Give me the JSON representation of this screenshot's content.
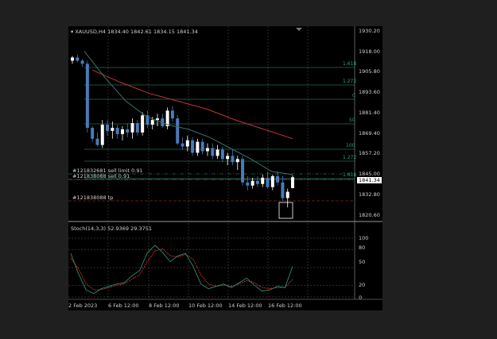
{
  "symbol_header": {
    "symbol": "XAUUSD,H4",
    "open": "1834.40",
    "high": "1842.61",
    "low": "1834.15",
    "close": "1841.34"
  },
  "price_scale": [
    "1930.20",
    "1918.00",
    "1905.80",
    "1893.60",
    "1881.40",
    "1869.40",
    "1857.20",
    "1845.00",
    "1832.80",
    "1820.60"
  ],
  "current_price": "1841.34",
  "fib_levels": [
    "1.618",
    "1.272",
    "0",
    "50",
    "100",
    "1.272",
    "1.618"
  ],
  "orders": {
    "sell_limit": "#121832681 sell limit 0.91",
    "sell": "#121838088 sell 0.91",
    "tp": "#121838088 tp"
  },
  "stochastic": {
    "title": "Stoch(14,3,3) 52.9369 29.3751",
    "scale": [
      "100",
      "80",
      "50",
      "20",
      "0"
    ]
  },
  "time_axis": [
    "2 Feb 2023",
    "6 Feb 12:00",
    "8 Feb 12:00",
    "10 Feb 12:00",
    "14 Feb 12:00",
    "16 Feb 12:00"
  ],
  "colors": {
    "background": "#000000",
    "bull_candle": "#ffffff",
    "bear_candle": "#4a7ab8",
    "slow_ma": "#c83232",
    "fast_ma": "#3f6f6a",
    "fib": "#2f9f7c",
    "stoch_main": "#2e8b6e",
    "stoch_signal": "#c83232"
  },
  "chart_data": {
    "type": "candlestick",
    "ylim": [
      1815,
      1933
    ],
    "candles": [
      [
        1916,
        1919,
        1914,
        1918
      ],
      [
        1918,
        1920,
        1915,
        1916
      ],
      [
        1916,
        1917,
        1912,
        1914
      ],
      [
        1914,
        1916,
        1870,
        1873
      ],
      [
        1873,
        1874,
        1864,
        1866
      ],
      [
        1866,
        1870,
        1861,
        1862
      ],
      [
        1862,
        1878,
        1860,
        1875
      ],
      [
        1875,
        1878,
        1868,
        1871
      ],
      [
        1871,
        1877,
        1866,
        1873
      ],
      [
        1873,
        1875,
        1866,
        1869
      ],
      [
        1869,
        1874,
        1865,
        1872
      ],
      [
        1872,
        1876,
        1867,
        1870
      ],
      [
        1870,
        1879,
        1866,
        1876
      ],
      [
        1876,
        1878,
        1868,
        1870
      ],
      [
        1870,
        1883,
        1868,
        1881
      ],
      [
        1881,
        1884,
        1873,
        1875
      ],
      [
        1875,
        1880,
        1872,
        1878
      ],
      [
        1878,
        1882,
        1874,
        1879
      ],
      [
        1879,
        1882,
        1873,
        1874
      ],
      [
        1874,
        1886,
        1872,
        1884
      ],
      [
        1884,
        1887,
        1877,
        1879
      ],
      [
        1879,
        1881,
        1862,
        1863
      ],
      [
        1863,
        1867,
        1859,
        1861
      ],
      [
        1861,
        1868,
        1858,
        1865
      ],
      [
        1865,
        1867,
        1855,
        1857
      ],
      [
        1857,
        1866,
        1855,
        1864
      ],
      [
        1864,
        1866,
        1856,
        1858
      ],
      [
        1858,
        1863,
        1855,
        1860
      ],
      [
        1860,
        1863,
        1853,
        1855
      ],
      [
        1855,
        1862,
        1853,
        1859
      ],
      [
        1859,
        1861,
        1851,
        1853
      ],
      [
        1853,
        1857,
        1849,
        1855
      ],
      [
        1855,
        1859,
        1849,
        1851
      ],
      [
        1851,
        1855,
        1846,
        1853
      ],
      [
        1853,
        1855,
        1836,
        1838
      ],
      [
        1838,
        1842,
        1833,
        1836
      ],
      [
        1836,
        1841,
        1834,
        1839
      ],
      [
        1839,
        1842,
        1835,
        1837
      ],
      [
        1837,
        1843,
        1835,
        1841
      ],
      [
        1841,
        1845,
        1834,
        1835
      ],
      [
        1835,
        1843,
        1833,
        1842
      ],
      [
        1842,
        1845,
        1836,
        1838
      ],
      [
        1838,
        1842,
        1826,
        1828
      ],
      [
        1828,
        1834,
        1822,
        1832
      ],
      [
        1834.4,
        1842.61,
        1834.15,
        1841.34
      ]
    ],
    "slow_ma": [
      1910,
      1902,
      1895,
      1890,
      1885,
      1878,
      1872,
      1866
    ],
    "fast_ma": [
      1922,
      1905,
      1890,
      1880,
      1875,
      1872,
      1867,
      1860,
      1853,
      1845,
      1843
    ],
    "stoch_main": [
      74,
      40,
      12,
      6,
      14,
      18,
      22,
      24,
      36,
      45,
      75,
      88,
      76,
      60,
      70,
      74,
      52,
      22,
      14,
      18,
      22,
      16,
      24,
      32,
      20,
      10,
      12,
      18,
      16,
      52
    ],
    "stoch_signal": [
      66,
      48,
      22,
      12,
      12,
      16,
      20,
      22,
      30,
      38,
      60,
      78,
      82,
      70,
      68,
      72,
      64,
      38,
      22,
      18,
      20,
      18,
      22,
      28,
      24,
      16,
      14,
      16,
      16,
      30
    ]
  }
}
